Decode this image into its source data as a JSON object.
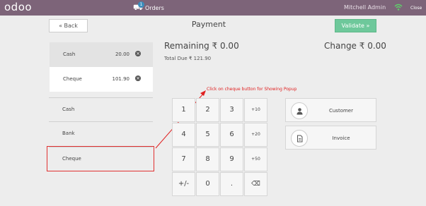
{
  "topbar": {
    "logo": "odoo",
    "orders_count": "1",
    "orders_label": "Orders",
    "user": "Mitchell Admin",
    "close_label": "Close"
  },
  "header": {
    "back_label": "« Back",
    "title": "Payment",
    "validate_label": "Validate »"
  },
  "payment_lines": [
    {
      "name": "Cash",
      "amount": "20.00",
      "delete_icon": "close-icon"
    },
    {
      "name": "Cheque",
      "amount": "101.90",
      "delete_icon": "close-icon"
    }
  ],
  "payment_methods": [
    "Cash",
    "Bank",
    "Cheque"
  ],
  "summary": {
    "remaining": "Remaining ₹ 0.00",
    "total_due": "Total Due  ₹ 121.90",
    "change": "Change ₹ 0.00"
  },
  "annotation": "Click on cheque button for Showing Popup",
  "numpad": {
    "keys": [
      "1",
      "2",
      "3",
      "+10",
      "4",
      "5",
      "6",
      "+20",
      "7",
      "8",
      "9",
      "+50",
      "+/-",
      "0",
      ".",
      "⌫"
    ]
  },
  "side_buttons": [
    {
      "label": "Customer",
      "icon": "user-icon"
    },
    {
      "label": "Invoice",
      "icon": "file-icon"
    }
  ],
  "colors": {
    "topbar": "#7d6479",
    "validate": "#6ec89b",
    "annotation": "#e02020"
  }
}
